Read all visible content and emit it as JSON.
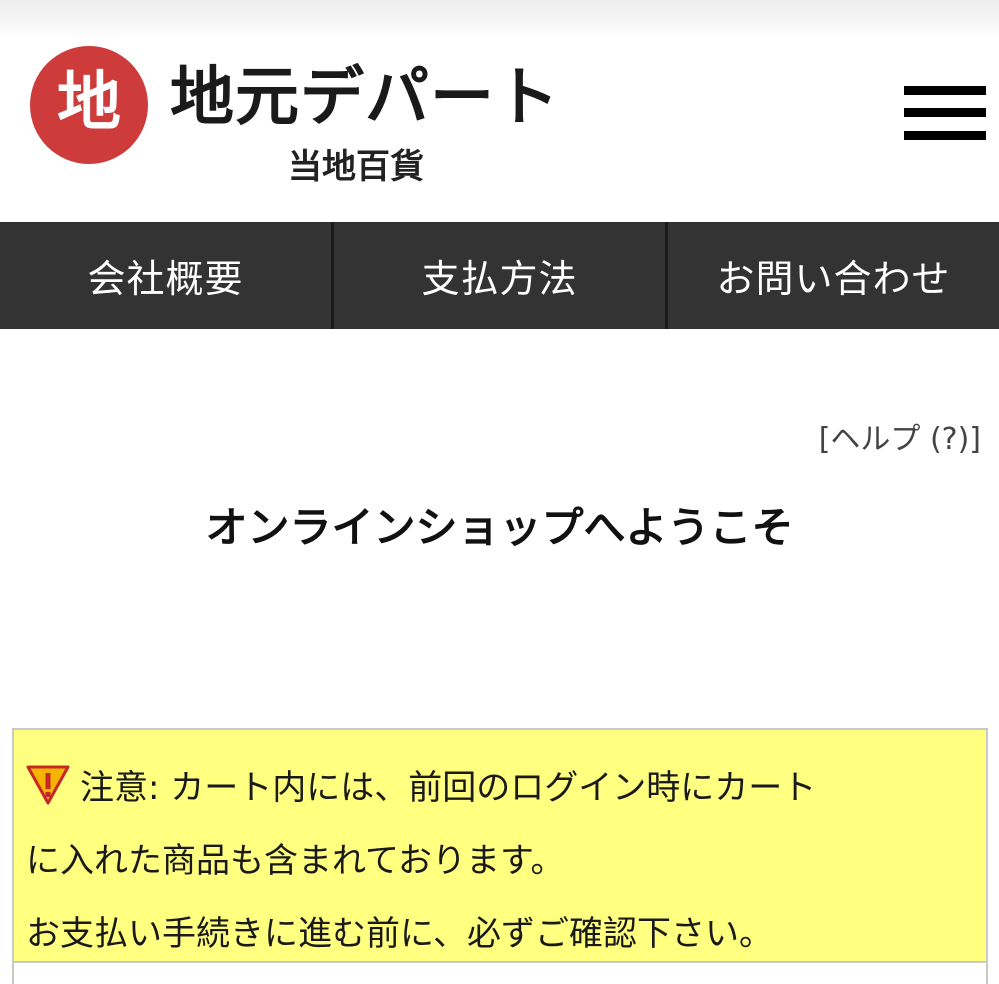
{
  "brand": {
    "mark": "地",
    "title": "地元デパート",
    "subtitle": "当地百貨"
  },
  "nav": {
    "items": [
      {
        "label": "会社概要"
      },
      {
        "label": "支払方法"
      },
      {
        "label": "お問い合わせ"
      }
    ]
  },
  "help": {
    "label": "[ヘルプ (?)]"
  },
  "welcome": {
    "title": "オンラインショップへようこそ"
  },
  "notice": {
    "line1": "注意: カート内には、前回のログイン時にカート",
    "line2": "に入れた商品も含まれております。",
    "line3": "お支払い手続きに進む前に、必ずご確認下さい。",
    "icon": "warning-icon"
  },
  "colors": {
    "brand_red": "#cd3b3b",
    "nav_bg": "#333333",
    "notice_bg": "#ffff80"
  }
}
